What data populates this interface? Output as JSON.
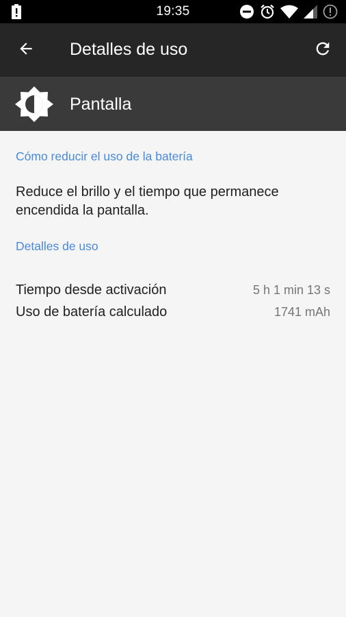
{
  "status_bar": {
    "time": "19:35",
    "icons": [
      "battery-alert-icon",
      "do-not-disturb-icon",
      "alarm-icon",
      "wifi-icon",
      "signal-icon",
      "alert-circle-icon"
    ]
  },
  "toolbar": {
    "title": "Detalles de uso",
    "back_icon": "arrow-back-icon",
    "refresh_icon": "refresh-icon"
  },
  "app_header": {
    "name": "Pantalla",
    "icon": "brightness-icon"
  },
  "sections": {
    "tip_title": "Cómo reducir el uso de la batería",
    "tip_text": "Reduce el brillo y el tiempo que permanece encendida la pantalla.",
    "details_title": "Detalles de uso"
  },
  "details": [
    {
      "label": "Tiempo desde activación",
      "value": "5 h 1 min 13 s"
    },
    {
      "label": "Uso de batería calculado",
      "value": "1741 mAh"
    }
  ],
  "colors": {
    "status_bar": "#000000",
    "toolbar": "#262626",
    "app_header": "#3a3a3a",
    "accent": "#4a89dc",
    "background": "#f5f5f5"
  }
}
